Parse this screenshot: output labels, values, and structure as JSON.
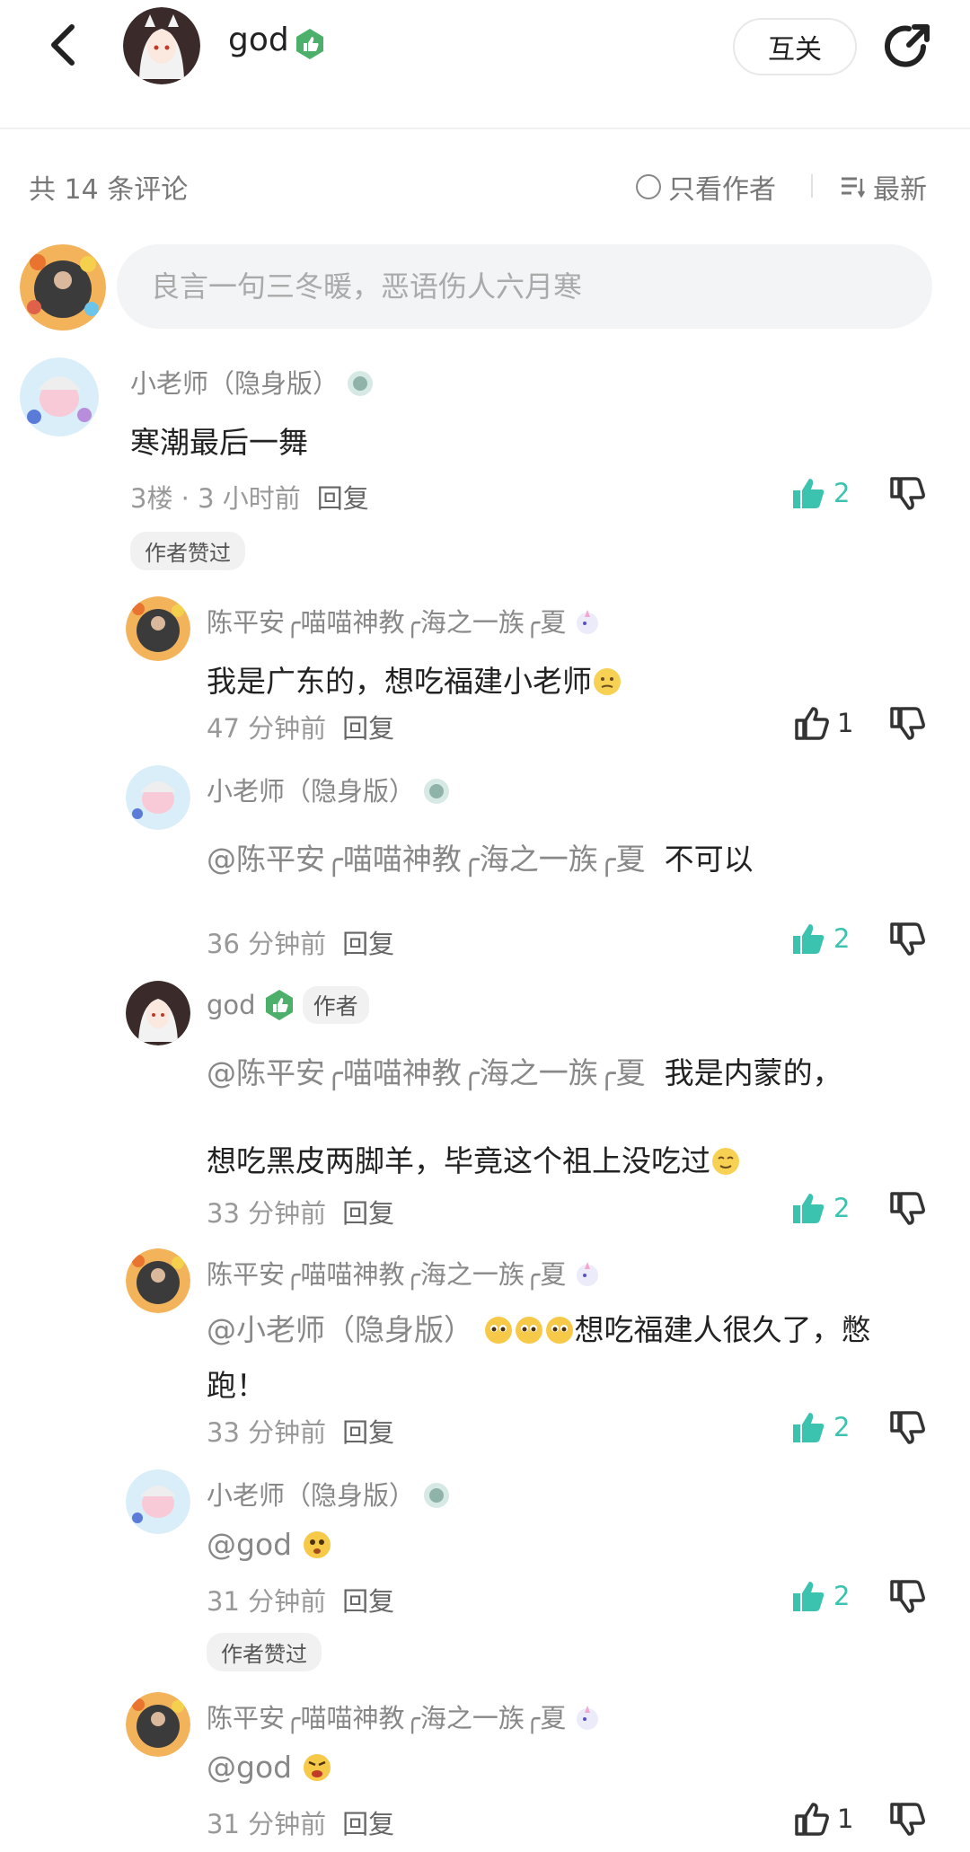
{
  "header": {
    "title": "god",
    "mutual_label": "互关"
  },
  "filter": {
    "count_label": "共 14 条评论",
    "only_author_label": "只看作者",
    "sort_label": "最新"
  },
  "input": {
    "placeholder": "良言一句三冬暖，恶语伤人六月寒"
  },
  "comments": [
    {
      "name": "小老师（隐身版）",
      "text": "寒潮最后一舞",
      "floor": "3楼",
      "time": "3 小时前",
      "reply": "回复",
      "likes": "2",
      "liked": true,
      "tag": "作者赞过"
    },
    {
      "name": "陈平安╭喵喵神教╭海之一族╭夏",
      "text": "我是广东的，想吃福建小老师",
      "time": "47 分钟前",
      "reply": "回复",
      "likes": "1",
      "liked": false
    },
    {
      "name": "小老师（隐身版）",
      "mention": "@陈平安╭喵喵神教╭海之一族╭夏",
      "text": "不可以",
      "time": "36 分钟前",
      "reply": "回复",
      "likes": "2",
      "liked": true
    },
    {
      "name": "god",
      "author_chip": "作者",
      "mention": "@陈平安╭喵喵神教╭海之一族╭夏",
      "text": "我是内蒙的，",
      "text2": "想吃黑皮两脚羊，毕竟这个祖上没吃过",
      "time": "33 分钟前",
      "reply": "回复",
      "likes": "2",
      "liked": true
    },
    {
      "name": "陈平安╭喵喵神教╭海之一族╭夏",
      "mention": "@小老师（隐身版）",
      "text": "想吃福建人很久了，憋",
      "text2": "跑！",
      "time": "33 分钟前",
      "reply": "回复",
      "likes": "2",
      "liked": true
    },
    {
      "name": "小老师（隐身版）",
      "mention": "@god",
      "time": "31 分钟前",
      "reply": "回复",
      "likes": "2",
      "liked": true,
      "tag": "作者赞过"
    },
    {
      "name": "陈平安╭喵喵神教╭海之一族╭夏",
      "mention": "@god",
      "time": "31 分钟前",
      "reply": "回复",
      "likes": "1",
      "liked": false
    }
  ],
  "colors": {
    "accent": "#3cc3b0",
    "badge_green": "#4caf6a"
  }
}
